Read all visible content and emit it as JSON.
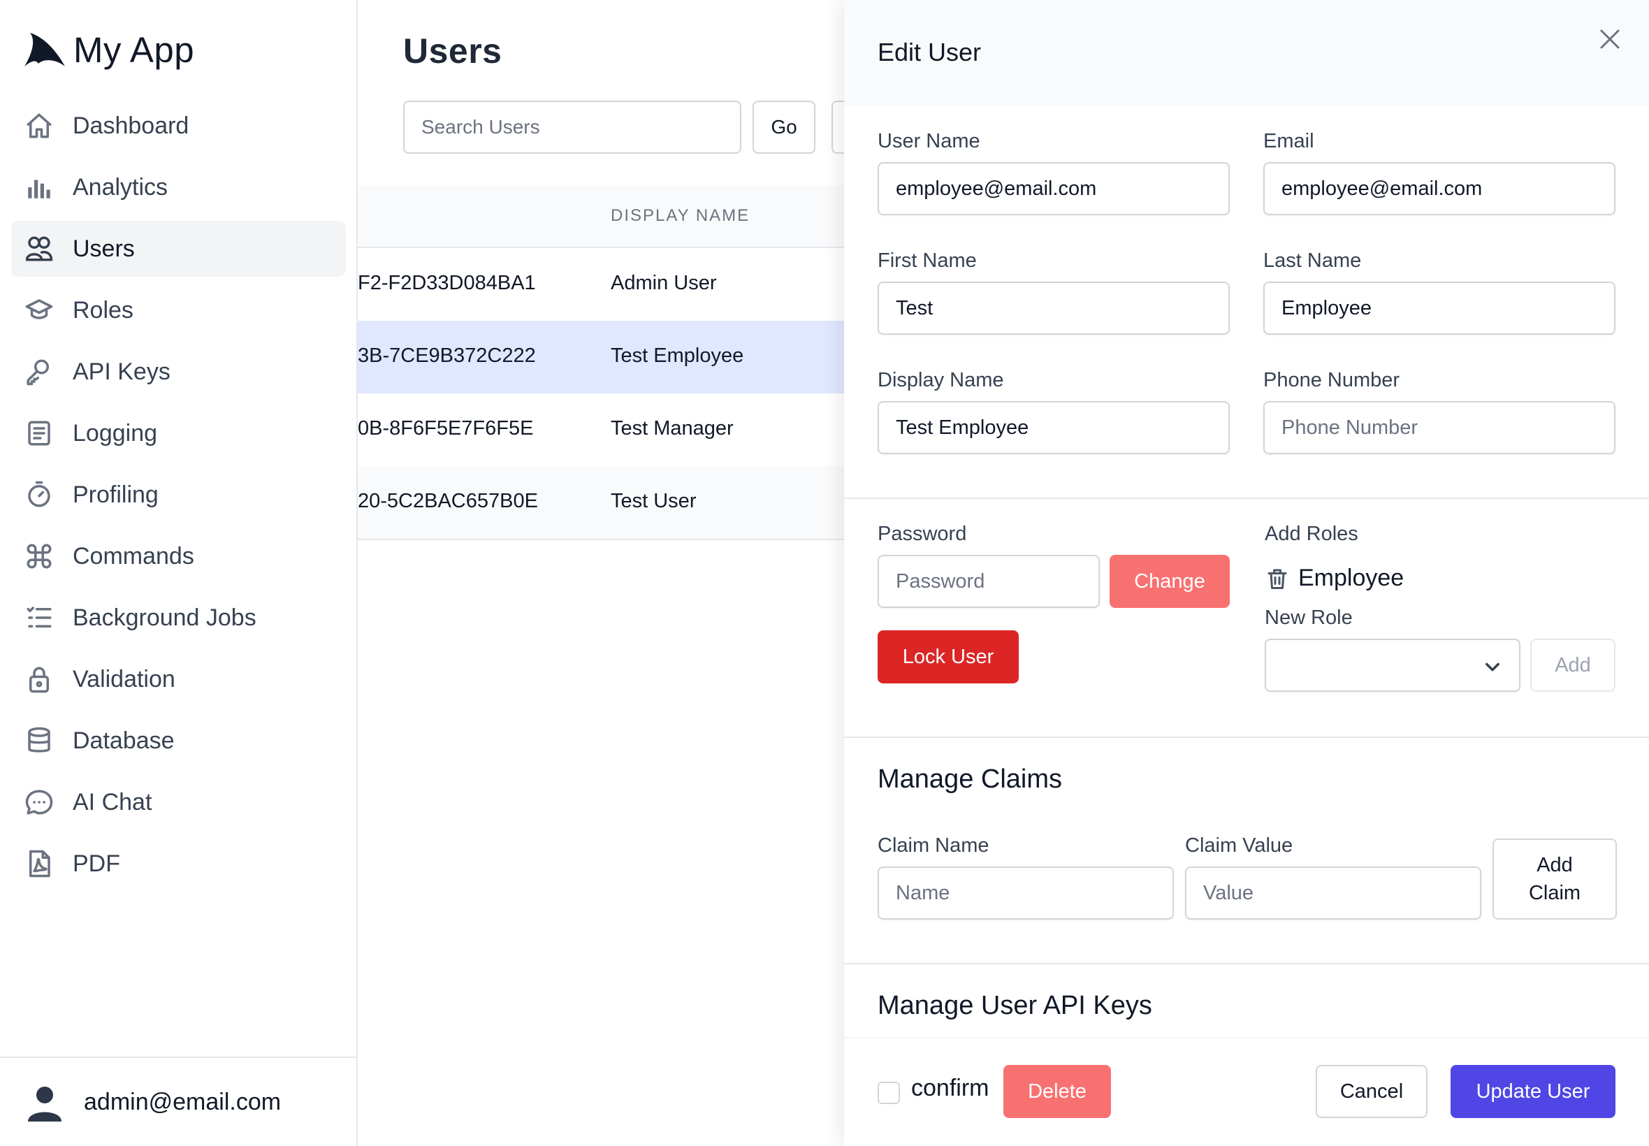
{
  "app": {
    "title": "My App"
  },
  "sidebar": {
    "items": [
      {
        "label": "Dashboard",
        "icon": "home-icon"
      },
      {
        "label": "Analytics",
        "icon": "bar-chart-icon"
      },
      {
        "label": "Users",
        "icon": "users-icon",
        "active": true
      },
      {
        "label": "Roles",
        "icon": "graduation-cap-icon"
      },
      {
        "label": "API Keys",
        "icon": "key-icon"
      },
      {
        "label": "Logging",
        "icon": "document-list-icon"
      },
      {
        "label": "Profiling",
        "icon": "stopwatch-icon"
      },
      {
        "label": "Commands",
        "icon": "command-icon"
      },
      {
        "label": "Background Jobs",
        "icon": "list-check-icon"
      },
      {
        "label": "Validation",
        "icon": "lock-icon"
      },
      {
        "label": "Database",
        "icon": "database-icon"
      },
      {
        "label": "AI Chat",
        "icon": "chat-bubble-icon"
      },
      {
        "label": "PDF",
        "icon": "pdf-file-icon"
      }
    ],
    "footer": {
      "email": "admin@email.com"
    }
  },
  "main": {
    "title": "Users",
    "search": {
      "placeholder": "Search Users"
    },
    "go_label": "Go",
    "table": {
      "headers": {
        "display_name": "DISPLAY NAME"
      },
      "rows": [
        {
          "id": "F2-F2D33D084BA1",
          "display_name": "Admin User"
        },
        {
          "id": "3B-7CE9B372C222",
          "display_name": "Test Employee"
        },
        {
          "id": "0B-8F6F5E7F6F5E",
          "display_name": "Test Manager"
        },
        {
          "id": "20-5C2BAC657B0E",
          "display_name": "Test User"
        }
      ]
    }
  },
  "edit_panel": {
    "title": "Edit User",
    "user_name": {
      "label": "User Name",
      "value": "employee@email.com"
    },
    "email": {
      "label": "Email",
      "value": "employee@email.com"
    },
    "first_name": {
      "label": "First Name",
      "value": "Test"
    },
    "last_name": {
      "label": "Last Name",
      "value": "Employee"
    },
    "display_name": {
      "label": "Display Name",
      "value": "Test Employee"
    },
    "phone_number": {
      "label": "Phone Number",
      "value": "",
      "placeholder": "Phone Number"
    },
    "password": {
      "label": "Password",
      "placeholder": "Password",
      "change_label": "Change"
    },
    "lock_user_label": "Lock User",
    "roles": {
      "label": "Add Roles",
      "current": [
        "Employee"
      ],
      "new_role_label": "New Role",
      "add_label": "Add"
    },
    "claims": {
      "title": "Manage Claims",
      "name_label": "Claim Name",
      "name_placeholder": "Name",
      "value_label": "Claim Value",
      "value_placeholder": "Value",
      "add_label": "Add Claim"
    },
    "api_keys": {
      "title": "Manage User API Keys"
    },
    "footer": {
      "confirm_label": "confirm",
      "delete_label": "Delete",
      "cancel_label": "Cancel",
      "update_label": "Update User"
    }
  },
  "colors": {
    "accent": "#4f46e5",
    "danger": "#dc2626",
    "danger_light": "#f87171",
    "selected_row": "#e0e7ff"
  }
}
